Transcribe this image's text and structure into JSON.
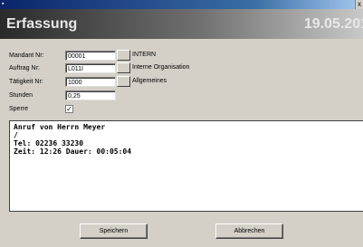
{
  "window": {
    "icon": "app-icon",
    "close_glyph": "x"
  },
  "header": {
    "title": "Erfassung",
    "date": "19.05.201"
  },
  "form": {
    "mandant": {
      "label": "Mandant Nr:",
      "value": "00001",
      "description": "INTERN"
    },
    "auftrag": {
      "label": "Auftrag Nr:",
      "value": "L011I",
      "description": "Interne Organisation"
    },
    "taetigkeit": {
      "label": "Tätigkeit Nr:",
      "value": "1000",
      "description": "Allgemeines"
    },
    "stunden": {
      "label": "Stunden",
      "value": "0,25"
    },
    "sperre": {
      "label": "Sperre",
      "checked": true,
      "mark": "✓"
    }
  },
  "memo": {
    "lines": [
      "Anruf von Herrn Meyer",
      "/",
      "Tel: 02236 33230",
      "Zeit: 12:26 Dauer: 00:05:04"
    ]
  },
  "buttons": {
    "save": "Speichern",
    "cancel": "Abbrechen"
  }
}
